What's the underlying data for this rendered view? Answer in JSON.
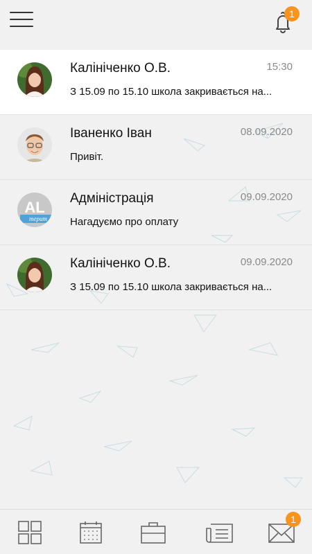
{
  "header": {
    "notifications_count": "1"
  },
  "messages": [
    {
      "name": "Калініченко О.В.",
      "time": "15:30",
      "preview": "З 15.09 по 15.10 школа закривається на...",
      "avatar": "woman-photo"
    },
    {
      "name": "Іваненко Іван",
      "time": "08.09.2020",
      "preview": "Привіт.",
      "avatar": "boy-photo"
    },
    {
      "name": "Адміністрація",
      "time": "09.09.2020",
      "preview": "Нагадуємо про оплату",
      "avatar": "al-logo",
      "avatar_text": "AL",
      "avatar_subtext": "терит"
    },
    {
      "name": "Калініченко О.В.",
      "time": "09.09.2020",
      "preview": "З 15.09 по 15.10 школа закривається на...",
      "avatar": "woman-photo"
    }
  ],
  "bottom_nav": {
    "items": [
      "dashboard-icon",
      "calendar-icon",
      "briefcase-icon",
      "newspaper-icon",
      "mail-icon"
    ],
    "mail_badge": "1"
  },
  "colors": {
    "accent": "#f7941d",
    "background": "#f1f1f1",
    "active_row": "#ffffff"
  }
}
